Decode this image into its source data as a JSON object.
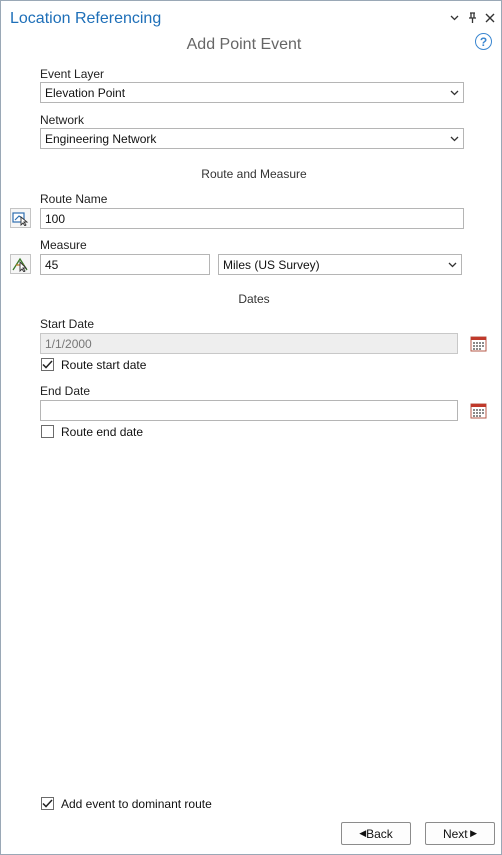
{
  "pane": {
    "title": "Location Referencing",
    "subtitle": "Add Point Event",
    "help_symbol": "?"
  },
  "window_controls": [
    "chevron-down-icon",
    "pin-icon",
    "close-icon"
  ],
  "event_layer": {
    "label": "Event Layer",
    "value": "Elevation Point"
  },
  "network": {
    "label": "Network",
    "value": "Engineering Network"
  },
  "route_section": {
    "heading": "Route and Measure"
  },
  "route_name": {
    "label": "Route Name",
    "value": "100"
  },
  "measure": {
    "label": "Measure",
    "value": "45",
    "units": "Miles (US Survey)"
  },
  "dates_section": {
    "heading": "Dates"
  },
  "start_date": {
    "label": "Start Date",
    "value": "1/1/2000",
    "checkbox_label": "Route start date",
    "checked": true
  },
  "end_date": {
    "label": "End Date",
    "value": "",
    "checkbox_label": "Route end date",
    "checked": false
  },
  "dominant_route": {
    "label": "Add event to dominant route",
    "checked": true
  },
  "buttons": {
    "back": "Back",
    "next": "Next"
  },
  "colors": {
    "title": "#1e6fb8",
    "calendar": "#c0392b",
    "help": "#3a86d0"
  }
}
